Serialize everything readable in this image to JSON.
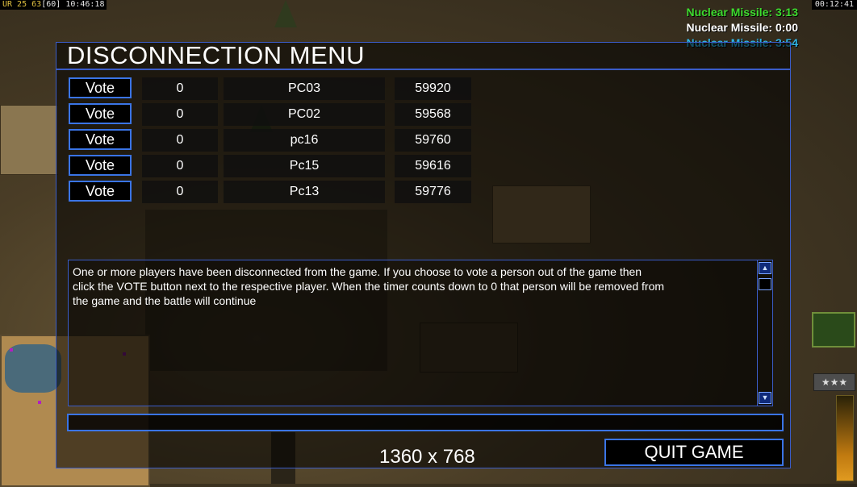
{
  "hud": {
    "top_left_ur": "UR 25",
    "top_left_fps": "63",
    "top_left_fps_cap": "[60]",
    "top_left_clock": "10:46:18",
    "top_right_clock": "00:12:41",
    "timers": [
      {
        "text": "Nuclear Missile: 3:13",
        "color": "#3ddc2e"
      },
      {
        "text": "Nuclear Missile: 0:00",
        "color": "#ffffff"
      },
      {
        "text": "Nuclear Missile: 3:54",
        "color": "#2fb6e6"
      }
    ],
    "rank_stars": "★★★"
  },
  "dialog": {
    "title": "DISCONNECTION MENU",
    "vote_label": "Vote",
    "players": [
      {
        "votes": "0",
        "name": "PC03",
        "ping": "59920"
      },
      {
        "votes": "0",
        "name": "PC02",
        "ping": "59568"
      },
      {
        "votes": "0",
        "name": "pc16",
        "ping": "59760"
      },
      {
        "votes": "0",
        "name": "Pc15",
        "ping": "59616"
      },
      {
        "votes": "0",
        "name": "Pc13",
        "ping": "59776"
      }
    ],
    "message": "One or more players have been disconnected from the game. If you choose to vote a person out of the game then\n click the VOTE button next to the respective player. When the timer counts down to 0 that person will be removed from\n the game and the battle will continue",
    "chat_value": "",
    "resolution": "1360 x 768",
    "quit_label": "QUIT GAME"
  },
  "colors": {
    "accent_border": "#3a74e6",
    "dialog_border": "#3a5cc8"
  }
}
